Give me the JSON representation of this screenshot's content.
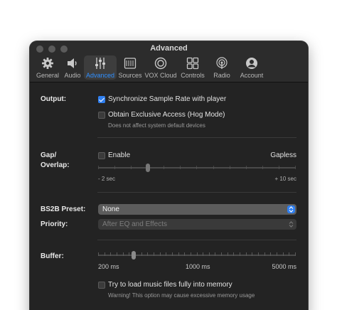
{
  "window": {
    "title": "Advanced"
  },
  "toolbar": {
    "items": [
      {
        "label": "General",
        "icon": "gear-icon"
      },
      {
        "label": "Audio",
        "icon": "speaker-icon"
      },
      {
        "label": "Advanced",
        "icon": "sliders-icon",
        "active": true
      },
      {
        "label": "Sources",
        "icon": "sources-icon"
      },
      {
        "label": "VOX Cloud",
        "icon": "cloud-icon"
      },
      {
        "label": "Controls",
        "icon": "controls-icon"
      },
      {
        "label": "Radio",
        "icon": "radio-icon"
      },
      {
        "label": "Account",
        "icon": "account-icon"
      }
    ]
  },
  "output": {
    "label": "Output:",
    "sync_label": "Synchronize Sample Rate with player",
    "sync_checked": true,
    "exclusive_label": "Obtain Exclusive Access (Hog Mode)",
    "exclusive_checked": false,
    "exclusive_note": "Does not affect system default devices"
  },
  "gap": {
    "label_line1": "Gap/",
    "label_line2": "Overlap:",
    "enable_label": "Enable",
    "enable_checked": false,
    "gapless_label": "Gapless",
    "min_label": "- 2 sec",
    "max_label": "+ 10 sec",
    "slider_fraction": 0.25
  },
  "bs2b": {
    "label": "BS2B Preset:",
    "value": "None"
  },
  "priority": {
    "label": "Priority:",
    "value": "After EQ and Effects"
  },
  "buffer": {
    "label": "Buffer:",
    "min_label": "200 ms",
    "mid_label": "1000 ms",
    "max_label": "5000 ms",
    "slider_fraction": 0.18,
    "load_label": "Try to load music files fully into memory",
    "load_checked": false,
    "warning": "Warning! This option may cause excessive memory usage"
  },
  "colors": {
    "accent": "#2f7ff0",
    "active_label": "#2f8fff"
  }
}
